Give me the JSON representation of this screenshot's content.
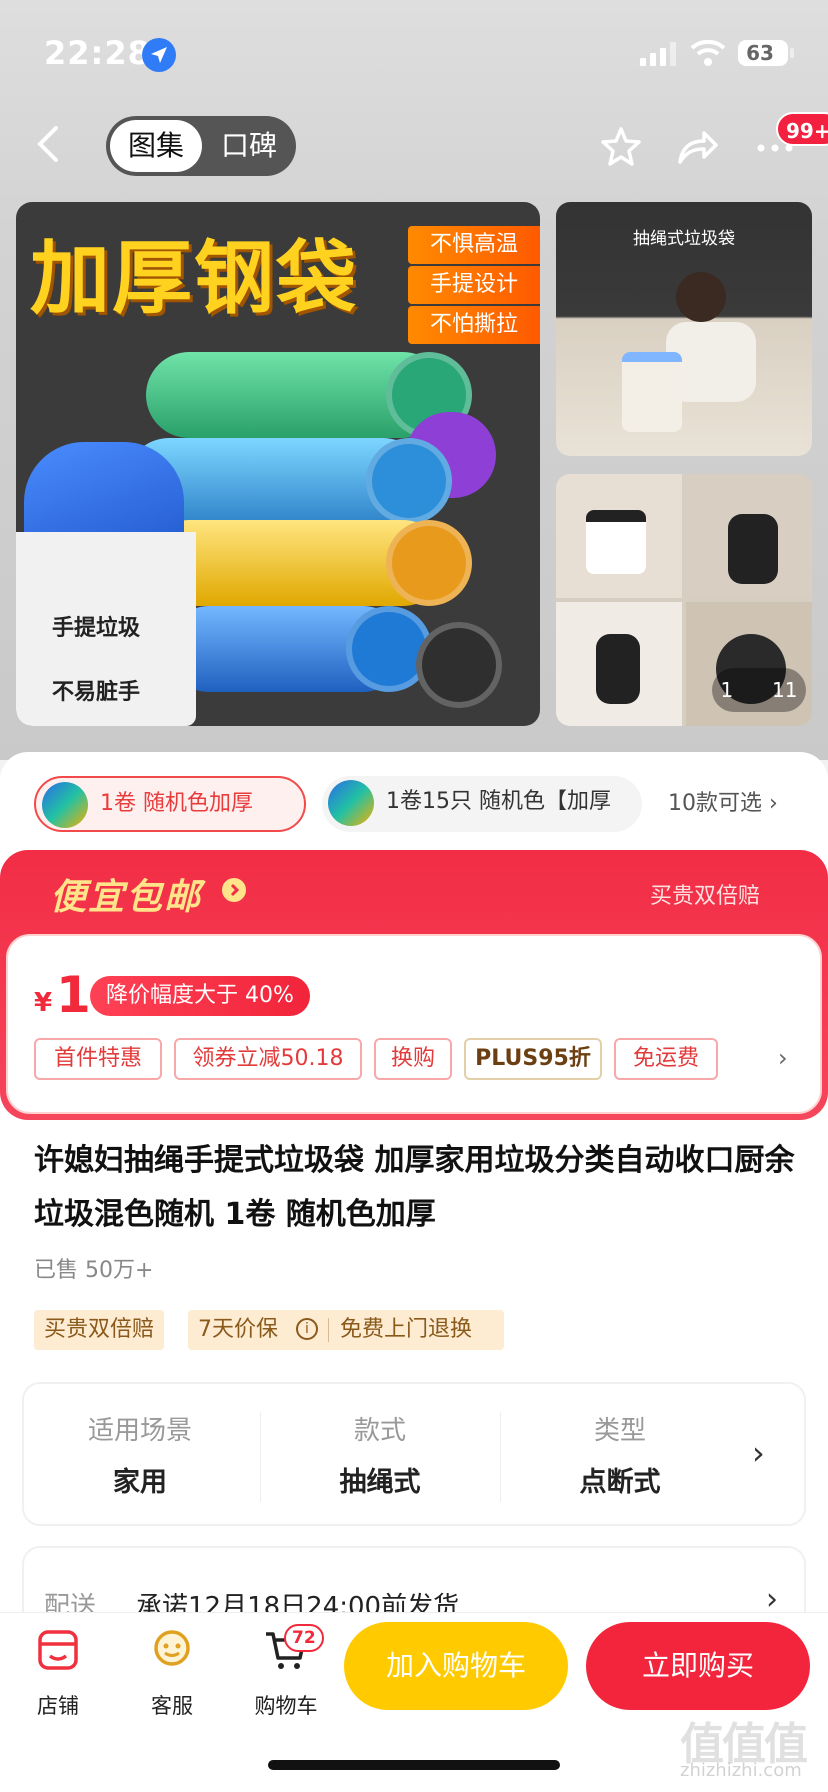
{
  "status_bar": {
    "time": "22:28",
    "battery": "63"
  },
  "nav": {
    "tab_active": "图集",
    "tab_inactive": "口碑",
    "badge": "99+"
  },
  "gallery": {
    "headline": "加厚钢袋",
    "features": [
      "不惧高温",
      "手提设计",
      "不怕撕拉"
    ],
    "bin_text_1": "手提垃圾",
    "bin_text_2": "不易脏手",
    "side_title": "抽绳式垃圾袋",
    "counter_current": "1",
    "counter_total": "11"
  },
  "variants": {
    "selected": "1卷 随机色加厚",
    "other": "1卷15只 随机色【加厚",
    "more": "10款可选 ›"
  },
  "promo": {
    "title": "便宜包邮",
    "right": "买贵双倍赔",
    "currency": "¥",
    "price": "1",
    "price_tag": "降价幅度大于 40%",
    "chips": [
      "首件特惠",
      "领券立减50.18",
      "换购",
      "PLUS95折",
      "免运费"
    ]
  },
  "product": {
    "title": "许媳妇抽绳手提式垃圾袋 加厚家用垃圾分类自动收口厨余垃圾混色随机 1卷 随机色加厚",
    "sold": "已售 50万+",
    "guarantee_1": "买贵双倍赔",
    "guarantee_2a": "7天价保",
    "guarantee_2b": "免费上门退换"
  },
  "attributes": [
    {
      "key": "适用场景",
      "value": "家用"
    },
    {
      "key": "款式",
      "value": "抽绳式"
    },
    {
      "key": "类型",
      "value": "点断式"
    }
  ],
  "delivery": {
    "label": "配送",
    "value": "承诺12月18日24:00前发货"
  },
  "bottom_bar": {
    "shop": "店铺",
    "service": "客服",
    "cart": "购物车",
    "cart_count": "72",
    "add_to_cart": "加入购物车",
    "buy_now": "立即购买"
  },
  "watermark": {
    "logo": "值值值",
    "site": "zhizhizhi.com"
  },
  "colors": {
    "accent_red": "#f3253c",
    "accent_yellow": "#ffcb00"
  }
}
